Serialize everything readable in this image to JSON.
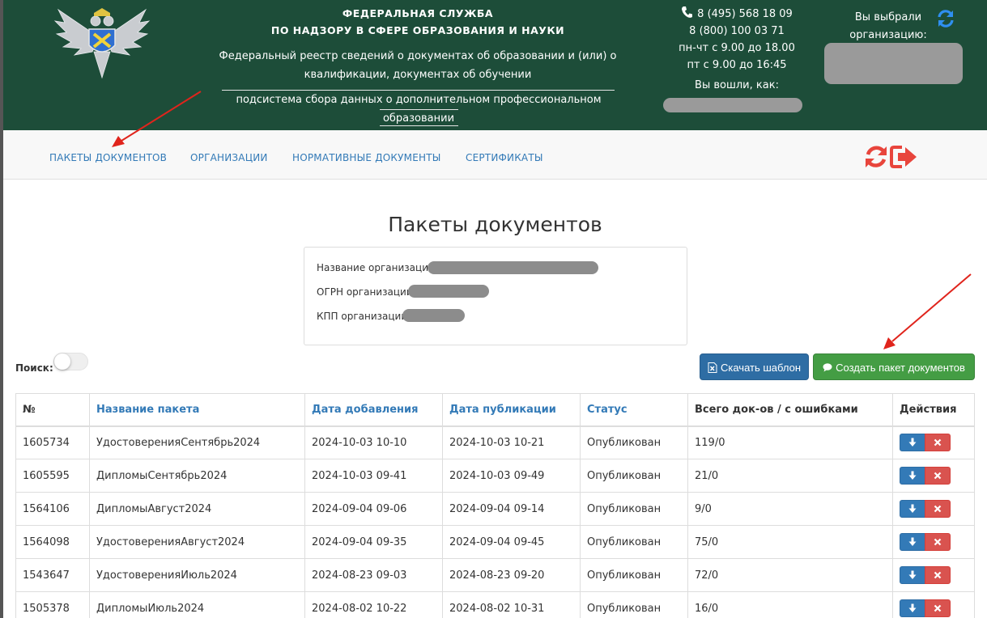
{
  "header": {
    "agency_line1": "ФЕДЕРАЛЬНАЯ СЛУЖБА",
    "agency_line2": "ПО НАДЗОРУ В СФЕРЕ ОБРАЗОВАНИЯ И НАУКИ",
    "registry_line1": "Федеральный реестр сведений о документах об образовании и (или) о",
    "registry_line2": "квалификации, документах об обучении",
    "subsystem_line1": "подсистема сбора данных о дополнительном профессиональном",
    "subsystem_line2": "образовании",
    "phone1": "8 (495) 568 18 09",
    "phone2": "8 (800) 100 03 71",
    "hours1": "пн-чт с 9.00 до 18.00",
    "hours2": "пт с 9.00 до 16:45",
    "logged_as": "Вы вошли, как:",
    "selected_org_line1": "Вы выбрали",
    "selected_org_line2": "организацию:",
    "header_bg": "#1d4d39"
  },
  "nav": {
    "items": [
      {
        "label": "ПАКЕТЫ ДОКУМЕНТОВ"
      },
      {
        "label": "ОРГАНИЗАЦИИ"
      },
      {
        "label": "НОРМАТИВНЫЕ ДОКУМЕНТЫ"
      },
      {
        "label": "СЕРТИФИКАТЫ"
      }
    ],
    "icons": [
      "refresh-icon",
      "logout-icon"
    ],
    "icon_color": "#e8453c"
  },
  "main": {
    "title": "Пакеты документов",
    "org_info": {
      "name_label": "Название организации:",
      "ogrn_label": "ОГРН организации:",
      "kpp_label": "КПП организации:"
    },
    "search_label": "Поиск:",
    "download_template_label": "Скачать шаблон",
    "create_package_label": "Создать пакет документов",
    "table": {
      "headers": [
        "№",
        "Название пакета",
        "Дата добавления",
        "Дата публикации",
        "Статус",
        "Всего док-ов / с ошибками",
        "Действия"
      ],
      "rows": [
        {
          "id": "1605734",
          "name": "УдостоверенияСентябрь2024",
          "added": "2024-10-03 10-10",
          "published": "2024-10-03 10-21",
          "status": "Опубликован",
          "docs": "119/0"
        },
        {
          "id": "1605595",
          "name": "ДипломыСентябрь2024",
          "added": "2024-10-03 09-41",
          "published": "2024-10-03 09-49",
          "status": "Опубликован",
          "docs": "21/0"
        },
        {
          "id": "1564106",
          "name": "ДипломыАвгуст2024",
          "added": "2024-09-04 09-06",
          "published": "2024-09-04 09-14",
          "status": "Опубликован",
          "docs": "9/0"
        },
        {
          "id": "1564098",
          "name": "УдостоверенияАвгуст2024",
          "added": "2024-09-04 09-35",
          "published": "2024-09-04 09-45",
          "status": "Опубликован",
          "docs": "75/0"
        },
        {
          "id": "1543647",
          "name": "УдостоверенияИюль2024",
          "added": "2024-08-23 09-03",
          "published": "2024-08-23 09-20",
          "status": "Опубликован",
          "docs": "72/0"
        },
        {
          "id": "1505378",
          "name": "ДипломыИюль2024",
          "added": "2024-08-02 10-22",
          "published": "2024-08-02 10-31",
          "status": "Опубликован",
          "docs": "16/0"
        }
      ]
    }
  }
}
